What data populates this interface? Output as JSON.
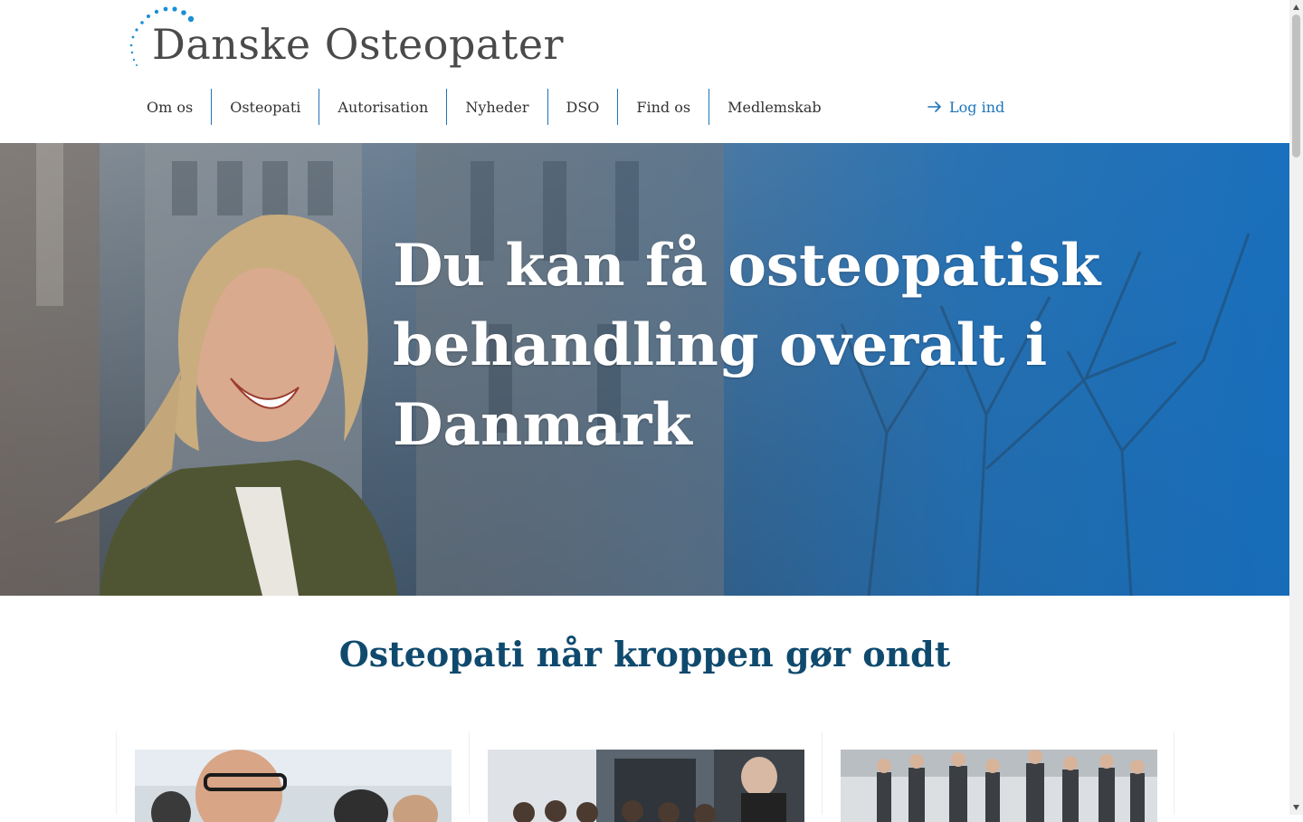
{
  "site": {
    "logo_text": "Danske Osteopater"
  },
  "nav": {
    "items": [
      {
        "label": "Om os"
      },
      {
        "label": "Osteopati"
      },
      {
        "label": "Autorisation"
      },
      {
        "label": "Nyheder"
      },
      {
        "label": "DSO"
      },
      {
        "label": "Find os"
      },
      {
        "label": "Medlemskab"
      }
    ],
    "login_label": "Log ind"
  },
  "hero": {
    "title": "Du kan få osteopatisk behandling overalt i Danmark"
  },
  "section": {
    "title": "Osteopati når kroppen gør ondt"
  },
  "colors": {
    "brand_blue": "#1c75bc",
    "heading_navy": "#0f4a6e"
  },
  "icons": {
    "login": "arrow-right-icon",
    "logo": "dotted-arc-icon"
  }
}
